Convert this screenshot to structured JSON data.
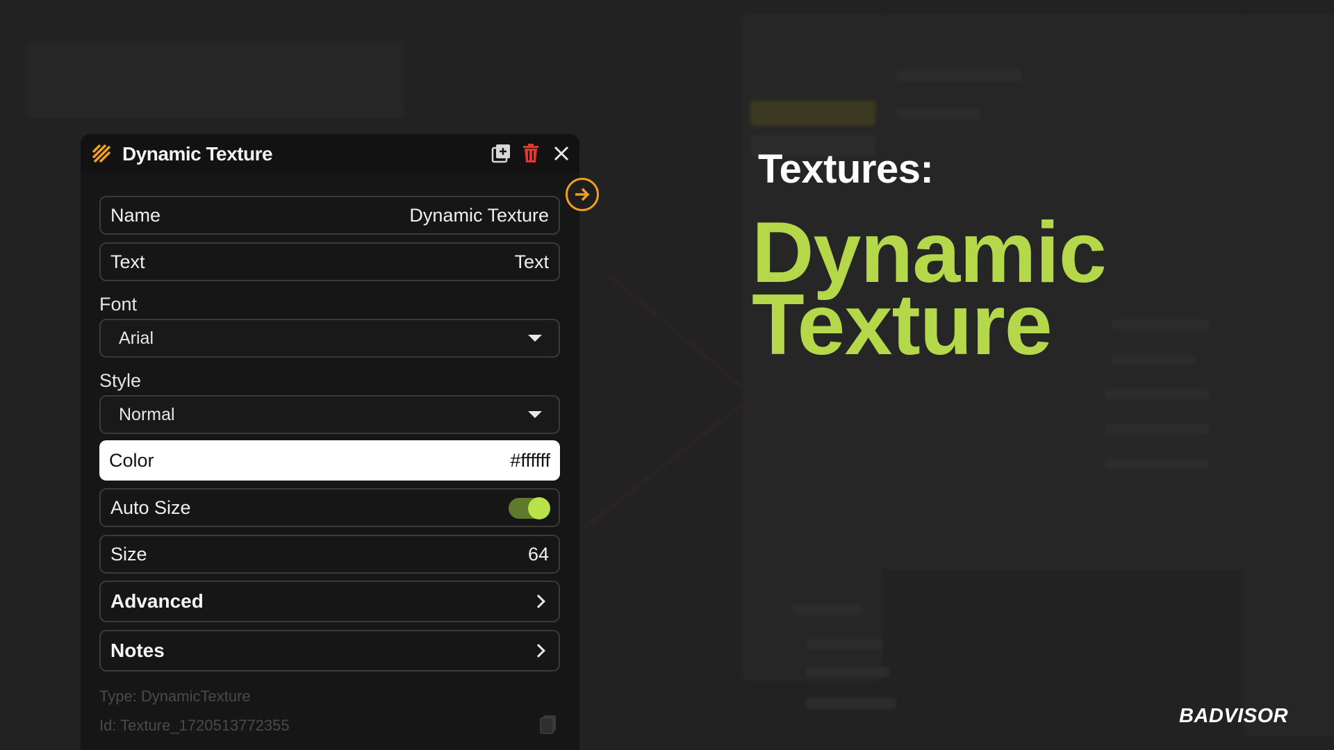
{
  "panel": {
    "title": "Dynamic Texture",
    "icon": "hatched-stripes-icon",
    "actions": [
      "duplicate-icon",
      "trash-icon",
      "close-icon"
    ],
    "accent_color": "#f0a020",
    "delete_color": "#e03a2a"
  },
  "fields": {
    "name": {
      "label": "Name",
      "value": "Dynamic Texture"
    },
    "text": {
      "label": "Text",
      "value": "Text"
    },
    "font": {
      "label": "Font",
      "selected": "Arial"
    },
    "style": {
      "label": "Style",
      "selected": "Normal"
    },
    "color": {
      "label": "Color",
      "value": "#ffffff"
    },
    "auto_size": {
      "label": "Auto Size",
      "enabled": true
    },
    "size": {
      "label": "Size",
      "value": "64"
    }
  },
  "sections": {
    "advanced": "Advanced",
    "notes": "Notes"
  },
  "meta": {
    "type": "Type: DynamicTexture",
    "id": "Id: Texture_1720513772355"
  },
  "headline": {
    "kicker": "Textures:",
    "title_line1": "Dynamic",
    "title_line2": "Texture",
    "title_color": "#b4d84a"
  },
  "brand": {
    "logo_text": "BADVISOR"
  }
}
